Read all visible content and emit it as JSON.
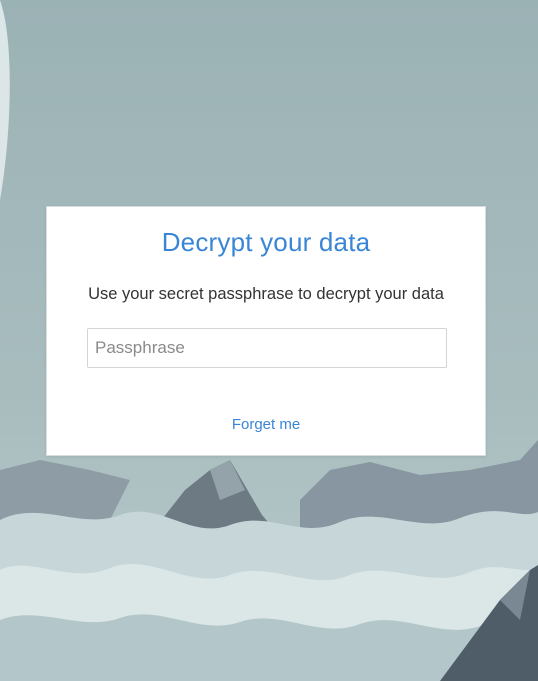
{
  "dialog": {
    "title": "Decrypt your data",
    "subtitle": "Use your secret passphrase to decrypt your data",
    "passphrase_value": "",
    "passphrase_placeholder": "Passphrase",
    "forget_label": "Forget me"
  },
  "colors": {
    "accent": "#3a86d6",
    "sky": "#9fb5b8",
    "mountain": "#6f7d86",
    "cloud": "#dfe9ea"
  }
}
